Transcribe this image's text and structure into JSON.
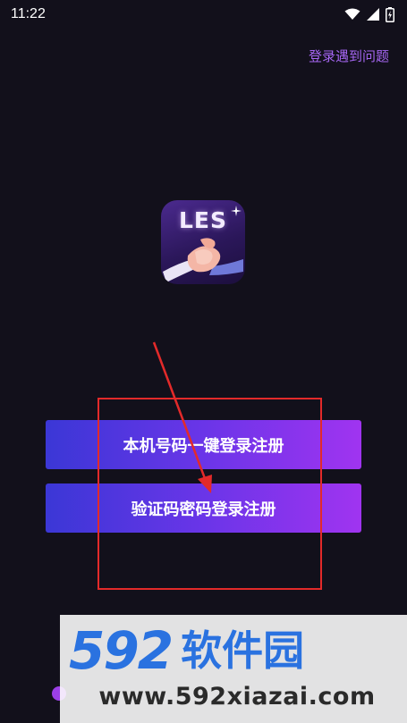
{
  "status_bar": {
    "time": "11:22",
    "icons": [
      "wifi-icon",
      "signal-icon",
      "battery-icon"
    ]
  },
  "header": {
    "help_link": "登录遇到问题"
  },
  "logo": {
    "text": "LES"
  },
  "buttons": {
    "one_click_login": "本机号码一键登录注册",
    "code_password_login": "验证码密码登录注册"
  },
  "watermark": {
    "number": "592",
    "name": "软件园",
    "url": "www.592xiazai.com"
  },
  "colors": {
    "background": "#12101b",
    "accent": "#a566f2",
    "button_start": "#3b37d6",
    "button_end": "#a034f0",
    "annotation": "#e32a2a",
    "watermark_blue": "#2a72e0"
  }
}
